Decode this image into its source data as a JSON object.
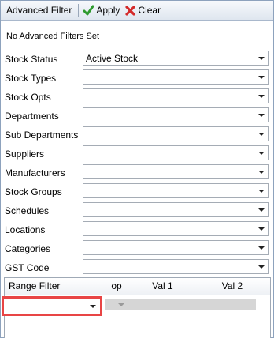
{
  "toolbar": {
    "title": "Advanced Filter",
    "apply_label": "Apply",
    "clear_label": "Clear",
    "apply_color": "#2e9a2e",
    "clear_color": "#d42a2a"
  },
  "status_text": "No Advanced Filters Set",
  "filters": [
    {
      "label": "Stock Status",
      "value": "Active Stock"
    },
    {
      "label": "Stock Types",
      "value": ""
    },
    {
      "label": "Stock Opts",
      "value": ""
    },
    {
      "label": "Departments",
      "value": ""
    },
    {
      "label": "Sub Departments",
      "value": ""
    },
    {
      "label": "Suppliers",
      "value": ""
    },
    {
      "label": "Manufacturers",
      "value": ""
    },
    {
      "label": "Stock Groups",
      "value": ""
    },
    {
      "label": "Schedules",
      "value": ""
    },
    {
      "label": "Locations",
      "value": ""
    },
    {
      "label": "Categories",
      "value": ""
    },
    {
      "label": "GST Code",
      "value": ""
    }
  ],
  "range_grid": {
    "columns": [
      "Range Filter",
      "op",
      "Val 1",
      "Val 2"
    ],
    "row": {
      "range_filter": "",
      "op": "",
      "val1": "",
      "val2": ""
    }
  },
  "highlight_color": "#e84545"
}
